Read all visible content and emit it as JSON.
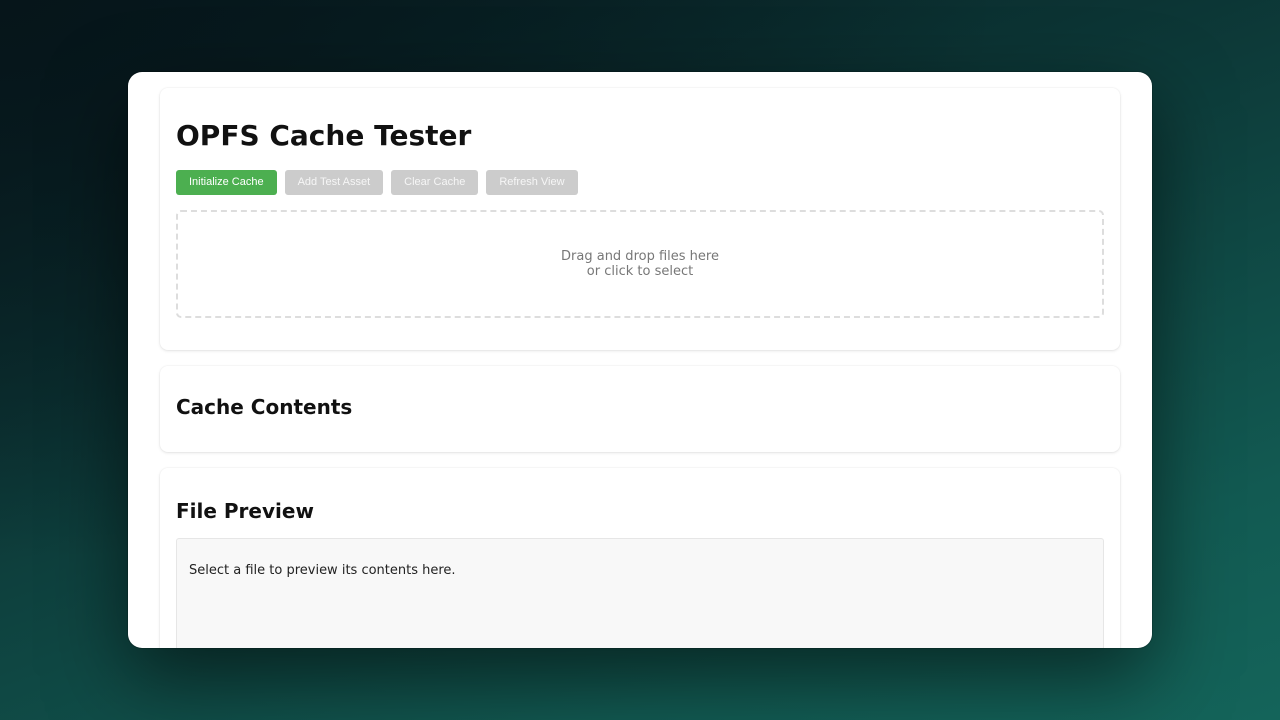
{
  "app": {
    "title": "OPFS Cache Tester"
  },
  "toolbar": {
    "initialize_label": "Initialize Cache",
    "add_test_asset_label": "Add Test Asset",
    "clear_cache_label": "Clear Cache",
    "refresh_view_label": "Refresh View"
  },
  "dropzone": {
    "line1": "Drag and drop files here",
    "line2": "or click to select"
  },
  "cache_contents": {
    "heading": "Cache Contents"
  },
  "file_preview": {
    "heading": "File Preview",
    "placeholder": "Select a file to preview its contents here."
  },
  "colors": {
    "primary_button": "#4caf50",
    "disabled_button": "#cccccc"
  }
}
